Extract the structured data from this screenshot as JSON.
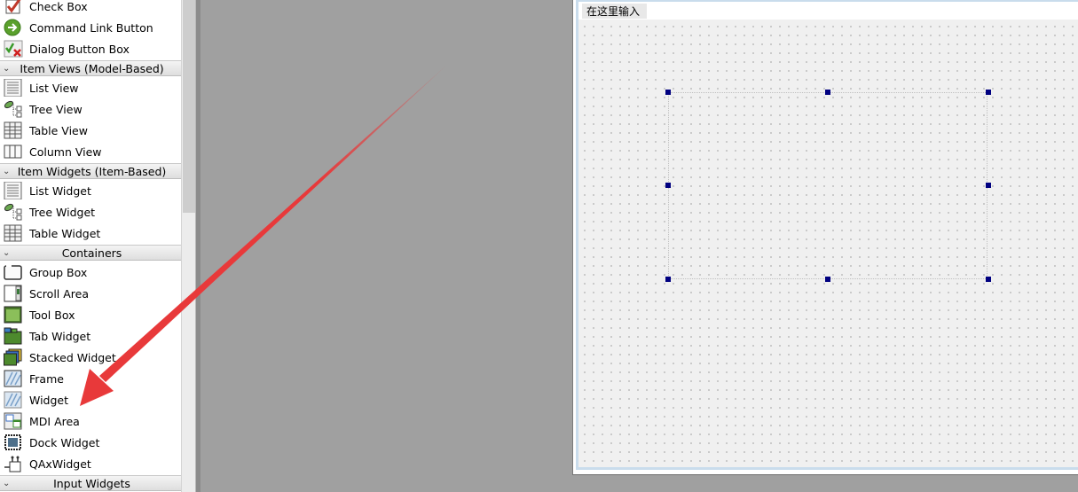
{
  "widget_box": {
    "items": [
      {
        "label": "Check Box",
        "icon": "check-box-icon"
      },
      {
        "label": "Command Link Button",
        "icon": "command-link-icon"
      },
      {
        "label": "Dialog Button Box",
        "icon": "dialog-button-box-icon"
      },
      {
        "label": "List View",
        "icon": "list-view-icon"
      },
      {
        "label": "Tree View",
        "icon": "tree-view-icon"
      },
      {
        "label": "Table View",
        "icon": "table-view-icon"
      },
      {
        "label": "Column View",
        "icon": "column-view-icon"
      },
      {
        "label": "List Widget",
        "icon": "list-widget-icon"
      },
      {
        "label": "Tree Widget",
        "icon": "tree-widget-icon"
      },
      {
        "label": "Table Widget",
        "icon": "table-widget-icon"
      },
      {
        "label": "Group Box",
        "icon": "group-box-icon"
      },
      {
        "label": "Scroll Area",
        "icon": "scroll-area-icon"
      },
      {
        "label": "Tool Box",
        "icon": "tool-box-icon"
      },
      {
        "label": "Tab Widget",
        "icon": "tab-widget-icon"
      },
      {
        "label": "Stacked Widget",
        "icon": "stacked-widget-icon"
      },
      {
        "label": "Frame",
        "icon": "frame-icon"
      },
      {
        "label": "Widget",
        "icon": "widget-icon"
      },
      {
        "label": "MDI Area",
        "icon": "mdi-area-icon"
      },
      {
        "label": "Dock Widget",
        "icon": "dock-widget-icon"
      },
      {
        "label": "QAxWidget",
        "icon": "qaxwidget-icon"
      }
    ],
    "categories": [
      {
        "label": "Item Views (Model-Based)"
      },
      {
        "label": "Item Widgets (Item-Based)"
      },
      {
        "label": "Containers"
      },
      {
        "label": "Input Widgets"
      }
    ]
  },
  "form": {
    "menu_placeholder": "在这里输入"
  },
  "colors": {
    "arrow": "#e8393a",
    "handle": "#000080",
    "canvas": "#f0f0f0"
  }
}
